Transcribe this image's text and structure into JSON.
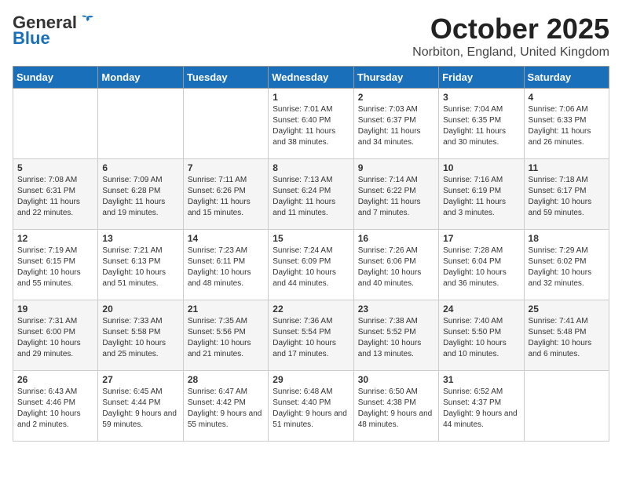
{
  "header": {
    "logo_general": "General",
    "logo_blue": "Blue",
    "title": "October 2025",
    "subtitle": "Norbiton, England, United Kingdom"
  },
  "days_of_week": [
    "Sunday",
    "Monday",
    "Tuesday",
    "Wednesday",
    "Thursday",
    "Friday",
    "Saturday"
  ],
  "weeks": [
    [
      {
        "day": "",
        "info": ""
      },
      {
        "day": "",
        "info": ""
      },
      {
        "day": "",
        "info": ""
      },
      {
        "day": "1",
        "info": "Sunrise: 7:01 AM\nSunset: 6:40 PM\nDaylight: 11 hours and 38 minutes."
      },
      {
        "day": "2",
        "info": "Sunrise: 7:03 AM\nSunset: 6:37 PM\nDaylight: 11 hours and 34 minutes."
      },
      {
        "day": "3",
        "info": "Sunrise: 7:04 AM\nSunset: 6:35 PM\nDaylight: 11 hours and 30 minutes."
      },
      {
        "day": "4",
        "info": "Sunrise: 7:06 AM\nSunset: 6:33 PM\nDaylight: 11 hours and 26 minutes."
      }
    ],
    [
      {
        "day": "5",
        "info": "Sunrise: 7:08 AM\nSunset: 6:31 PM\nDaylight: 11 hours and 22 minutes."
      },
      {
        "day": "6",
        "info": "Sunrise: 7:09 AM\nSunset: 6:28 PM\nDaylight: 11 hours and 19 minutes."
      },
      {
        "day": "7",
        "info": "Sunrise: 7:11 AM\nSunset: 6:26 PM\nDaylight: 11 hours and 15 minutes."
      },
      {
        "day": "8",
        "info": "Sunrise: 7:13 AM\nSunset: 6:24 PM\nDaylight: 11 hours and 11 minutes."
      },
      {
        "day": "9",
        "info": "Sunrise: 7:14 AM\nSunset: 6:22 PM\nDaylight: 11 hours and 7 minutes."
      },
      {
        "day": "10",
        "info": "Sunrise: 7:16 AM\nSunset: 6:19 PM\nDaylight: 11 hours and 3 minutes."
      },
      {
        "day": "11",
        "info": "Sunrise: 7:18 AM\nSunset: 6:17 PM\nDaylight: 10 hours and 59 minutes."
      }
    ],
    [
      {
        "day": "12",
        "info": "Sunrise: 7:19 AM\nSunset: 6:15 PM\nDaylight: 10 hours and 55 minutes."
      },
      {
        "day": "13",
        "info": "Sunrise: 7:21 AM\nSunset: 6:13 PM\nDaylight: 10 hours and 51 minutes."
      },
      {
        "day": "14",
        "info": "Sunrise: 7:23 AM\nSunset: 6:11 PM\nDaylight: 10 hours and 48 minutes."
      },
      {
        "day": "15",
        "info": "Sunrise: 7:24 AM\nSunset: 6:09 PM\nDaylight: 10 hours and 44 minutes."
      },
      {
        "day": "16",
        "info": "Sunrise: 7:26 AM\nSunset: 6:06 PM\nDaylight: 10 hours and 40 minutes."
      },
      {
        "day": "17",
        "info": "Sunrise: 7:28 AM\nSunset: 6:04 PM\nDaylight: 10 hours and 36 minutes."
      },
      {
        "day": "18",
        "info": "Sunrise: 7:29 AM\nSunset: 6:02 PM\nDaylight: 10 hours and 32 minutes."
      }
    ],
    [
      {
        "day": "19",
        "info": "Sunrise: 7:31 AM\nSunset: 6:00 PM\nDaylight: 10 hours and 29 minutes."
      },
      {
        "day": "20",
        "info": "Sunrise: 7:33 AM\nSunset: 5:58 PM\nDaylight: 10 hours and 25 minutes."
      },
      {
        "day": "21",
        "info": "Sunrise: 7:35 AM\nSunset: 5:56 PM\nDaylight: 10 hours and 21 minutes."
      },
      {
        "day": "22",
        "info": "Sunrise: 7:36 AM\nSunset: 5:54 PM\nDaylight: 10 hours and 17 minutes."
      },
      {
        "day": "23",
        "info": "Sunrise: 7:38 AM\nSunset: 5:52 PM\nDaylight: 10 hours and 13 minutes."
      },
      {
        "day": "24",
        "info": "Sunrise: 7:40 AM\nSunset: 5:50 PM\nDaylight: 10 hours and 10 minutes."
      },
      {
        "day": "25",
        "info": "Sunrise: 7:41 AM\nSunset: 5:48 PM\nDaylight: 10 hours and 6 minutes."
      }
    ],
    [
      {
        "day": "26",
        "info": "Sunrise: 6:43 AM\nSunset: 4:46 PM\nDaylight: 10 hours and 2 minutes."
      },
      {
        "day": "27",
        "info": "Sunrise: 6:45 AM\nSunset: 4:44 PM\nDaylight: 9 hours and 59 minutes."
      },
      {
        "day": "28",
        "info": "Sunrise: 6:47 AM\nSunset: 4:42 PM\nDaylight: 9 hours and 55 minutes."
      },
      {
        "day": "29",
        "info": "Sunrise: 6:48 AM\nSunset: 4:40 PM\nDaylight: 9 hours and 51 minutes."
      },
      {
        "day": "30",
        "info": "Sunrise: 6:50 AM\nSunset: 4:38 PM\nDaylight: 9 hours and 48 minutes."
      },
      {
        "day": "31",
        "info": "Sunrise: 6:52 AM\nSunset: 4:37 PM\nDaylight: 9 hours and 44 minutes."
      },
      {
        "day": "",
        "info": ""
      }
    ]
  ]
}
